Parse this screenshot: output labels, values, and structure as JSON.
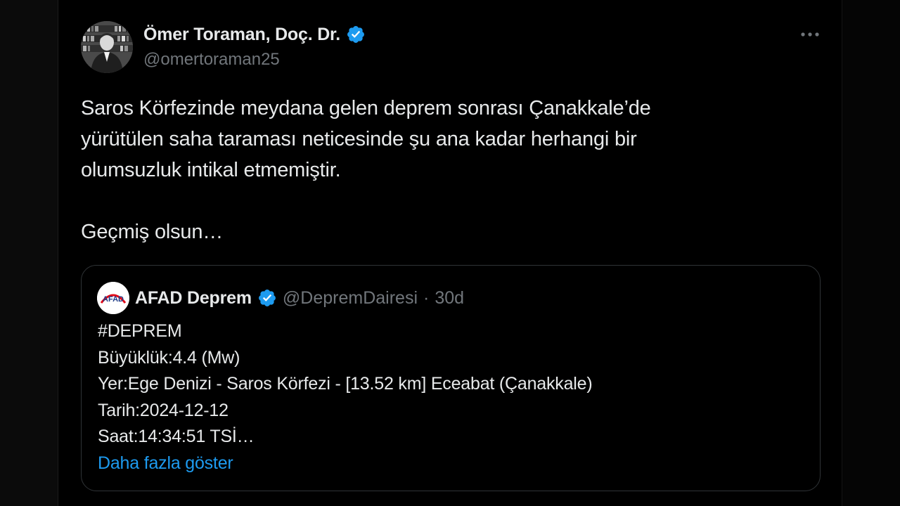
{
  "tweet": {
    "author": {
      "name": "Ömer Toraman, Doç. Dr.",
      "handle": "@omertoraman25",
      "verified_color": "#1d9bf0"
    },
    "more_icon": "more-horizontal-icon",
    "text": {
      "line1": "Saros Körfezinde meydana gelen deprem sonrası Çanakkale’de",
      "line2": "yürütülen saha taraması neticesinde şu ana kadar herhangi bir",
      "line3": "olumsuzluk intikal etmemiştir.",
      "line4": "Geçmiş olsun…"
    },
    "quote": {
      "avatar_text": "AFAD",
      "name": "AFAD Deprem",
      "handle": "@DepremDairesi",
      "separator": "·",
      "time": "30d",
      "lines": [
        "#DEPREM",
        "Büyüklük:4.4 (Mw)",
        "Yer:Ege Denizi - Saros Körfezi - [13.52 km] Eceabat (Çanakkale)",
        "Tarih:2024-12-12",
        "Saat:14:34:51 TSİ…"
      ],
      "show_more": "Daha fazla göster"
    }
  },
  "colors": {
    "background": "#000000",
    "text": "#e7e9ea",
    "secondary": "#71767b",
    "link": "#1d9bf0",
    "border": "#2f3336",
    "afad_red": "#e30a17",
    "afad_blue": "#1f3c88"
  }
}
